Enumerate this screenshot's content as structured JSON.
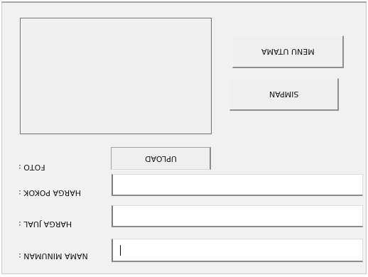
{
  "form": {
    "photo_label": "FOTO :",
    "buttons": {
      "menu_utama": "MENU UTAMA",
      "simpan": "SIMPAN",
      "upload": "UPLOAD"
    },
    "fields": {
      "harga_pokok": {
        "label": "HARGA POKOK :",
        "value": ""
      },
      "harga_jual": {
        "label": "HARGA JUAL :",
        "value": ""
      },
      "nama_minuman": {
        "label": "NAMA MINUMAN :",
        "value": ""
      }
    }
  },
  "colors": {
    "window_bg": "#f1f1f1",
    "field_bg": "#ffffff",
    "border_dark": "#8a8a8a"
  }
}
